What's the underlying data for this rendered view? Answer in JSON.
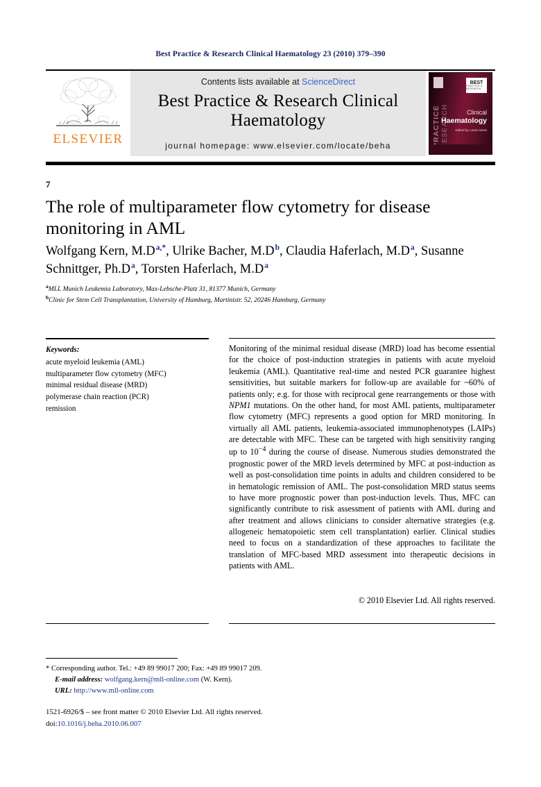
{
  "running_head": "Best Practice & Research Clinical Haematology 23 (2010) 379–390",
  "header": {
    "contents_prefix": "Contents lists available at ",
    "sciencedirect": "ScienceDirect",
    "journal_title": "Best Practice & Research Clinical Haematology",
    "homepage": "journal homepage: www.elsevier.com/locate/beha",
    "publisher_logo_text": "ELSEVIER",
    "cover": {
      "spine_text": "PRACTICE",
      "spine_text2": "RESEARCH",
      "badge_main": "BEST",
      "badge_sub": "PRACTICE & RESEARCH",
      "title_line1": "Clinical",
      "title_line2": "Haematology",
      "editor_line": "Edited by\nLaurie Moss"
    }
  },
  "article": {
    "number": "7",
    "title": "The role of multiparameter flow cytometry for disease monitoring in AML",
    "authors": [
      {
        "name": "Wolfgang Kern, M.D",
        "marks": "a,*",
        "sep": ", "
      },
      {
        "name": "Ulrike Bacher, M.D",
        "marks": "b",
        "sep": ", "
      },
      {
        "name": "Claudia Haferlach, M.D",
        "marks": "a",
        "sep": ", "
      },
      {
        "name": "Susanne Schnittger, Ph.D",
        "marks": "a",
        "sep": ", "
      },
      {
        "name": "Torsten Haferlach, M.D",
        "marks": "a",
        "sep": ""
      }
    ],
    "affiliations": [
      {
        "mark": "a",
        "text": "MLL Munich Leukemia Laboratory, Max-Lebsche-Platz 31, 81377 Munich, Germany"
      },
      {
        "mark": "b",
        "text": "Clinic for Stem Cell Transplantation, University of Hamburg, Martinistr. 52, 20246 Hamburg, Germany"
      }
    ]
  },
  "keywords": {
    "title": "Keywords:",
    "items": [
      "acute myeloid leukemia (AML)",
      "multiparameter flow cytometry (MFC)",
      "minimal residual disease (MRD)",
      "polymerase chain reaction (PCR)",
      "remission"
    ]
  },
  "abstract": {
    "part1": "Monitoring of the minimal residual disease (MRD) load has become essential for the choice of post-induction strategies in patients with acute myeloid leukemia (AML). Quantitative real-time and nested PCR guarantee highest sensitivities, but suitable markers for follow-up are available for ~60% of patients only; e.g. for those with reciprocal gene rearrangements or those with ",
    "italic1": "NPM1",
    "part2": " mutations. On the other hand, for most AML patients, multiparameter flow cytometry (MFC) represents a good option for MRD monitoring. In virtually all AML patients, leukemia-associated immunophenotypes (LAIPs) are detectable with MFC. These can be targeted with high sensitivity ranging up to 10",
    "superscript": "−4",
    "part3": " during the course of disease. Numerous studies demonstrated the prognostic power of the MRD levels determined by MFC at post-induction as well as post-consolidation time points in adults and children considered to be in hematologic remission of AML. The post-consolidation MRD status seems to have more prognostic power than post-induction levels. Thus, MFC can significantly contribute to risk assessment of patients with AML during and after treatment and allows clinicians to consider alternative strategies (e.g. allogeneic hematopoietic stem cell transplantation) earlier. Clinical studies need to focus on a standardization of these approaches to facilitate the translation of MFC-based MRD assessment into therapeutic decisions in patients with AML.",
    "copyright": "© 2010 Elsevier Ltd. All rights reserved."
  },
  "footnote": {
    "corresponding": "* Corresponding author. Tel.: +49 89 99017 200; Fax: +49 89 99017 209.",
    "email_label": "E-mail address:",
    "email": "wolfgang.kern@mll-online.com",
    "email_suffix": "(W. Kern).",
    "url_label": "URL:",
    "url": "http://www.mll-online.com"
  },
  "footer": {
    "issn_line": "1521-6926/$ – see front matter © 2010 Elsevier Ltd. All rights reserved.",
    "doi_label": "doi:",
    "doi": "10.1016/j.beha.2010.06.007"
  }
}
